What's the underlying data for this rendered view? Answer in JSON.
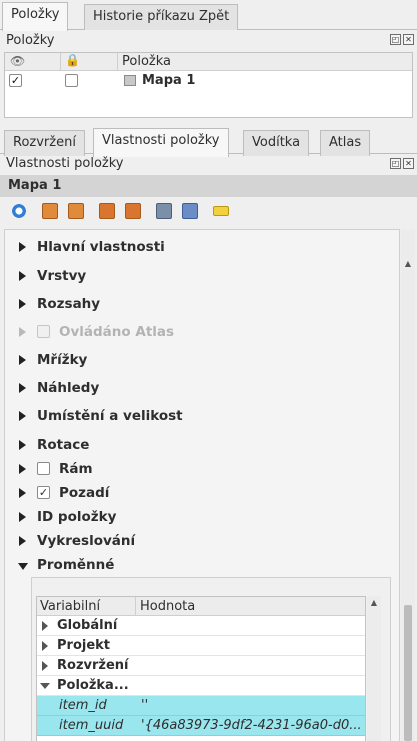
{
  "top_tabs": [
    "Položky",
    "Historie příkazu Zpět"
  ],
  "items_dock": {
    "title": "Položky",
    "columns": {
      "visible_icon": "eye-icon",
      "lock_icon": "lock-icon",
      "item": "Položka"
    },
    "rows": [
      {
        "visible": true,
        "locked": false,
        "name": "Mapa 1"
      }
    ]
  },
  "props_tabs": [
    "Rozvržení",
    "Vlastnosti položky",
    "Vodítka",
    "Atlas"
  ],
  "props_dock": {
    "title": "Vlastnosti položky"
  },
  "item_name": "Mapa 1",
  "groups": [
    {
      "label": "Hlavní vlastnosti"
    },
    {
      "label": "Vrstvy"
    },
    {
      "label": "Rozsahy"
    },
    {
      "label": "Ovládáno Atlas"
    },
    {
      "label": "Mřížky"
    },
    {
      "label": "Náhledy"
    },
    {
      "label": "Umístění a velikost"
    },
    {
      "label": "Rotace"
    },
    {
      "label": "Rám"
    },
    {
      "label": "Pozadí"
    },
    {
      "label": "ID položky"
    },
    {
      "label": "Vykreslování"
    },
    {
      "label": "Proměnné"
    }
  ],
  "variables": {
    "columns": [
      "Variabilní",
      "Hodnota"
    ],
    "groups": [
      "Globální",
      "Projekt",
      "Rozvržení",
      "Položka..."
    ],
    "rows": [
      {
        "name": "item_id",
        "value": "''"
      },
      {
        "name": "item_uuid",
        "value": "'{46a83973-9df2-4231-96a0-d0..."
      }
    ]
  },
  "colors": {
    "selection": "#99e6ee",
    "header_bg": "#d4d4d4"
  }
}
